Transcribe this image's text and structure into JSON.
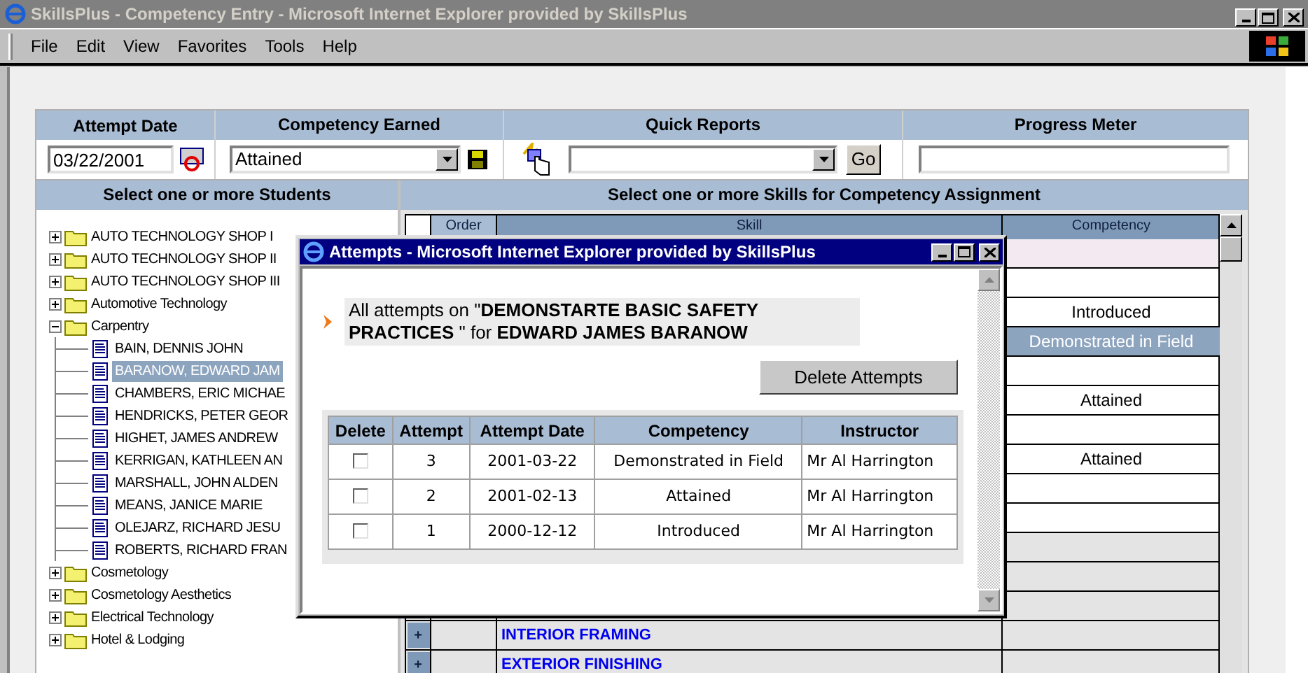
{
  "window": {
    "title": "SkillsPlus - Competency Entry - Microsoft Internet Explorer provided by SkillsPlus"
  },
  "menu": [
    "File",
    "Edit",
    "View",
    "Favorites",
    "Tools",
    "Help"
  ],
  "controls": {
    "attempt_date_label": "Attempt Date",
    "attempt_date": "03/22/2001",
    "competency_label": "Competency Earned",
    "competency": "Attained",
    "quick_reports_label": "Quick Reports",
    "go": "Go",
    "progress_label": "Progress Meter"
  },
  "students": {
    "title": "Select one or more Students",
    "groups": [
      {
        "label": "AUTO TECHNOLOGY SHOP I",
        "expanded": false
      },
      {
        "label": "AUTO TECHNOLOGY SHOP II",
        "expanded": false
      },
      {
        "label": "AUTO TECHNOLOGY SHOP III",
        "expanded": false
      },
      {
        "label": "Automotive Technology",
        "expanded": false
      },
      {
        "label": "Carpentry",
        "expanded": true,
        "children": [
          {
            "label": "BAIN, DENNIS JOHN",
            "selected": false
          },
          {
            "label": "BARANOW, EDWARD JAM",
            "selected": true
          },
          {
            "label": "CHAMBERS, ERIC MICHAE",
            "selected": false
          },
          {
            "label": "HENDRICKS, PETER GEOR",
            "selected": false
          },
          {
            "label": "HIGHET, JAMES ANDREW",
            "selected": false
          },
          {
            "label": "KERRIGAN, KATHLEEN AN",
            "selected": false
          },
          {
            "label": "MARSHALL, JOHN ALDEN",
            "selected": false
          },
          {
            "label": "MEANS, JANICE MARIE",
            "selected": false
          },
          {
            "label": "OLEJARZ, RICHARD JESU",
            "selected": false
          },
          {
            "label": "ROBERTS, RICHARD FRAN",
            "selected": false
          }
        ]
      },
      {
        "label": "Cosmetology",
        "expanded": false
      },
      {
        "label": "Cosmetology Aesthetics",
        "expanded": false
      },
      {
        "label": "Electrical Technology",
        "expanded": false
      },
      {
        "label": "Hotel & Lodging",
        "expanded": false
      }
    ]
  },
  "skills": {
    "title": "Select one or more Skills for Competency Assignment",
    "columns": [
      "Order",
      "Skill",
      "Competency"
    ],
    "rows": [
      {
        "selected": false
      },
      {
        "selected": false
      },
      {
        "competency": "Introduced",
        "selected": false
      },
      {
        "competency": "Demonstrated in Field",
        "selected": true
      },
      {
        "selected": false
      },
      {
        "competency": "Attained",
        "selected": false
      },
      {
        "selected": false
      },
      {
        "competency": "Attained",
        "selected": false
      },
      {
        "selected": false
      },
      {
        "selected": false
      },
      {
        "selected": false
      },
      {
        "selected": false
      },
      {
        "selected": false
      },
      {
        "expand": "+",
        "skill": "INTERIOR FRAMING",
        "selected": false
      },
      {
        "expand": "+",
        "skill": "EXTERIOR FINISHING",
        "selected": false
      }
    ]
  },
  "popup": {
    "title": "Attempts - Microsoft Internet Explorer provided by SkillsPlus",
    "message": "All attempts on \"**DEMONSTARTE BASIC SAFETY PRACTICES** \" for **EDWARD JAMES BARANOW**",
    "delete_button": "Delete Attempts",
    "columns": [
      "Delete",
      "Attempt",
      "Attempt Date",
      "Competency",
      "Instructor"
    ],
    "rows": [
      {
        "checked": false,
        "attempt": "3",
        "date": "2001-03-22",
        "competency": "Demonstrated in Field",
        "instructor": "Mr Al Harrington"
      },
      {
        "checked": false,
        "attempt": "2",
        "date": "2001-02-13",
        "competency": "Attained",
        "instructor": "Mr Al Harrington"
      },
      {
        "checked": false,
        "attempt": "1",
        "date": "2000-12-12",
        "competency": "Introduced",
        "instructor": "Mr Al Harrington"
      }
    ]
  }
}
